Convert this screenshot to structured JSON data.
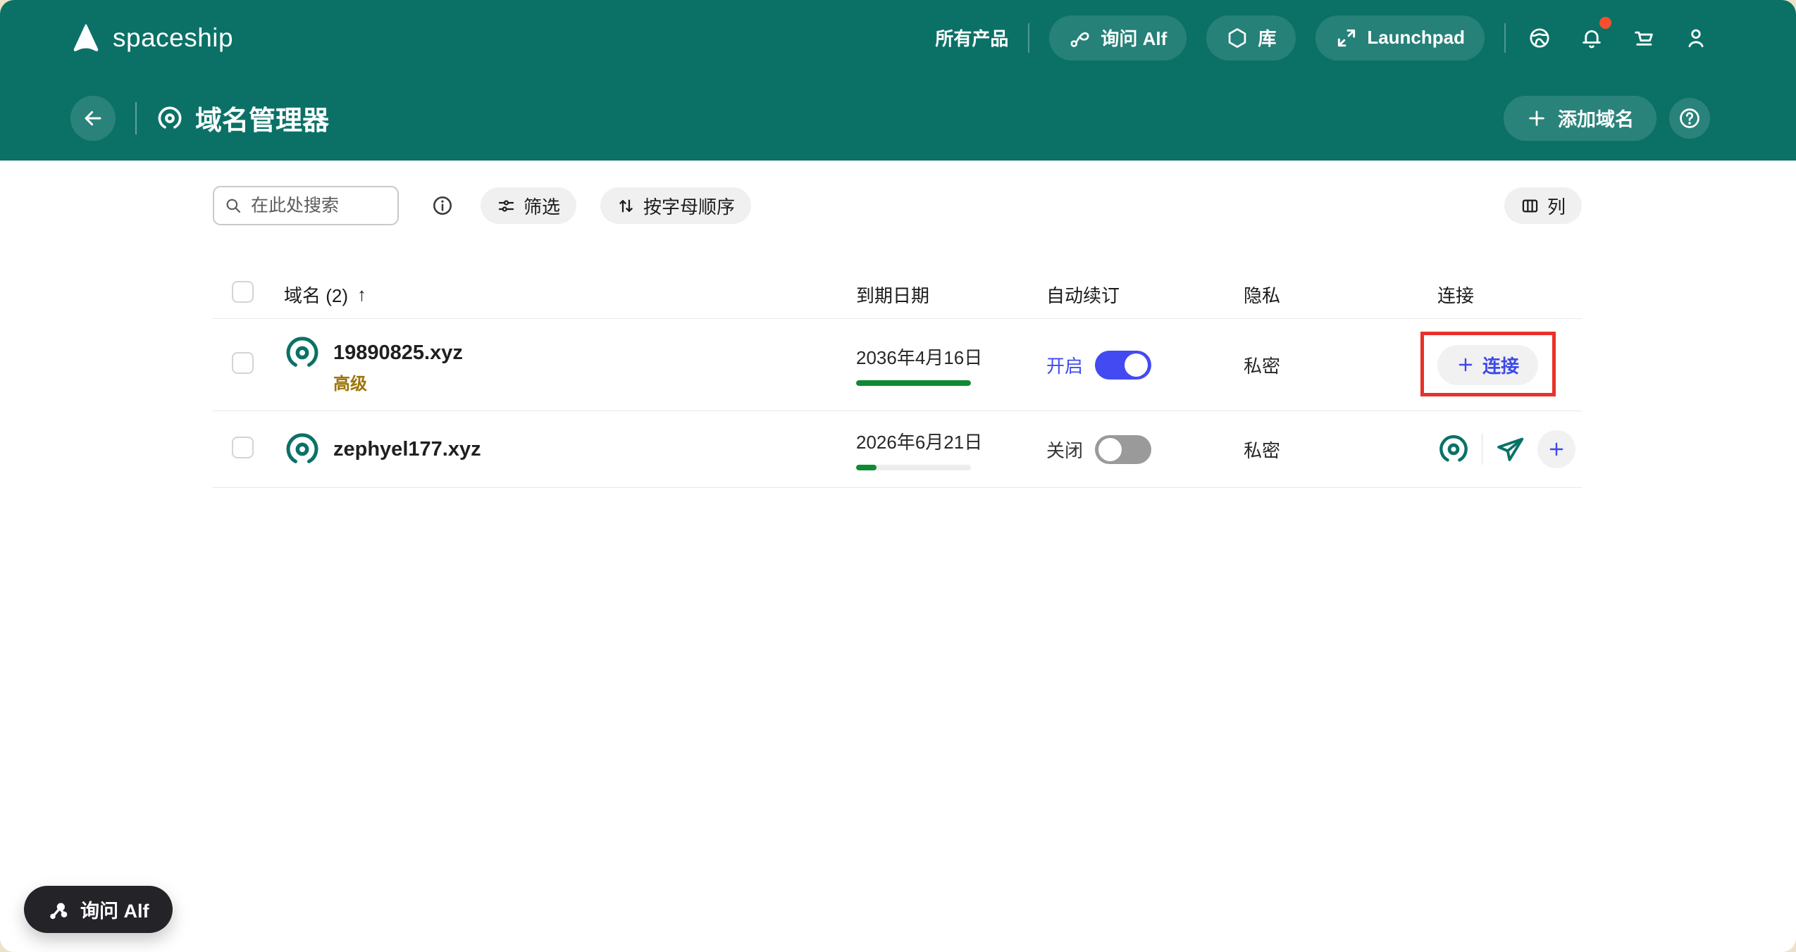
{
  "colors": {
    "header_teal": "#0b7167",
    "accent_blue": "#434af2",
    "progress_green": "#0e8a33",
    "badge_gold": "#9c7508",
    "annotation_red": "#e8312a",
    "notification_dot": "#f4502f",
    "floating_dark": "#232328"
  },
  "topbar": {
    "logo": "spaceship",
    "all_products": "所有产品",
    "ask_alf": "询问 Alf",
    "library": "库",
    "launchpad": "Launchpad"
  },
  "subheader": {
    "title": "域名管理器",
    "add_domain": "添加域名"
  },
  "toolbar": {
    "search_placeholder": "在此处搜索",
    "filter": "筛选",
    "sort": "按字母顺序",
    "columns": "列"
  },
  "table": {
    "headers": {
      "name": "域名 (2)",
      "sort_dir": "↑",
      "expiry": "到期日期",
      "auto_renew": "自动续订",
      "privacy": "隐私",
      "connect": "连接"
    },
    "rows": [
      {
        "domain": "19890825.xyz",
        "badge": "高级",
        "expiry": "2036年4月16日",
        "progress_pct": 100,
        "auto_renew_on": true,
        "auto_renew_label": "开启",
        "privacy": "私密",
        "connect_label": "连接"
      },
      {
        "domain": "zephyel177.xyz",
        "expiry": "2026年6月21日",
        "progress_pct": 18,
        "auto_renew_on": false,
        "auto_renew_label": "关闭",
        "privacy": "私密"
      }
    ]
  },
  "floating": {
    "ask_alf": "询问 Alf"
  }
}
